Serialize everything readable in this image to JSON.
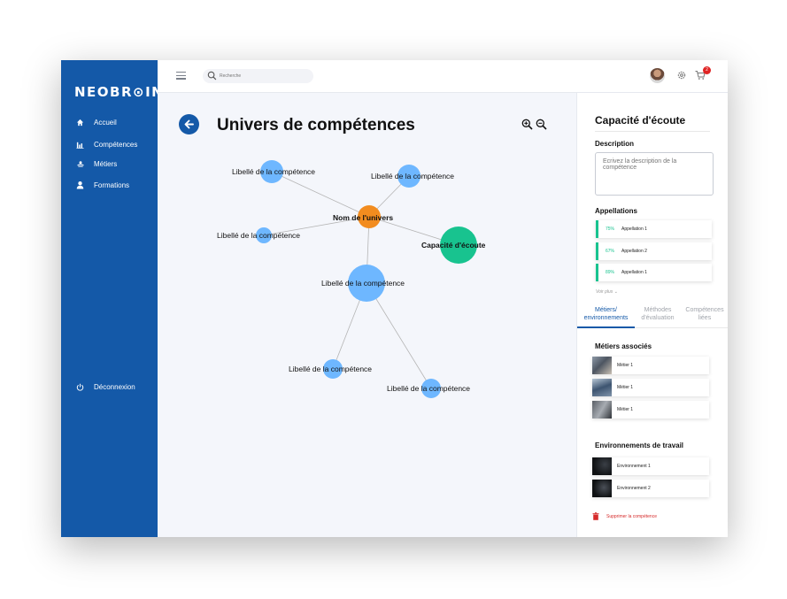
{
  "sidebar": {
    "logo": "NEOBR⊙IN",
    "items": [
      {
        "label": "Accueil",
        "icon": "home-icon"
      },
      {
        "label": "Compétences",
        "icon": "bar-chart-icon"
      },
      {
        "label": "Métiers",
        "icon": "briefcase-icon"
      },
      {
        "label": "Formations",
        "icon": "person-icon"
      }
    ],
    "logout": {
      "label": "Déconnexion",
      "icon": "power-icon"
    }
  },
  "topbar": {
    "search_placeholder": "Recherche",
    "notification_count": "2"
  },
  "main": {
    "title": "Univers de compétences"
  },
  "graph": {
    "center": {
      "label": "Nom de l'univers"
    },
    "selected": {
      "label": "Capacité d'écoute"
    },
    "nodes": [
      {
        "label": "Libellé de la compétence"
      },
      {
        "label": "Libellé de la compétence"
      },
      {
        "label": "Libellé de la compétence"
      },
      {
        "label": "Libellé de la compétence"
      },
      {
        "label": "Libellé de la compétence"
      },
      {
        "label": "Libellé de la compétence"
      }
    ],
    "colors": {
      "center": "#f28c1f",
      "selected": "#18c38f",
      "node": "#6eb7ff",
      "edge": "#b5b5b5"
    }
  },
  "panel": {
    "title": "Capacité d'écoute",
    "description_label": "Description",
    "description_placeholder": "Ecrivez la description de la compétence",
    "appellations_label": "Appellations",
    "appellations": [
      {
        "percent": "75%",
        "name": "Appellation 1"
      },
      {
        "percent": "67%",
        "name": "Appellation 2"
      },
      {
        "percent": "89%",
        "name": "Appellation 1"
      }
    ],
    "voir_plus": "Voir plus",
    "tabs": [
      {
        "line1": "Métiers/",
        "line2": "environnements",
        "active": true
      },
      {
        "line1": "Méthodes",
        "line2": "d'évaluation",
        "active": false
      },
      {
        "line1": "Compétences",
        "line2": "liées",
        "active": false
      }
    ],
    "metiers_label": "Métiers associés",
    "metiers": [
      "Métier 1",
      "Métier 1",
      "Métier 1"
    ],
    "env_label": "Environnements de travail",
    "environnements": [
      "Environnement 1",
      "Environnement 2"
    ],
    "delete_label": "Supprimer la compétence"
  },
  "accent_color": "#1459a8"
}
